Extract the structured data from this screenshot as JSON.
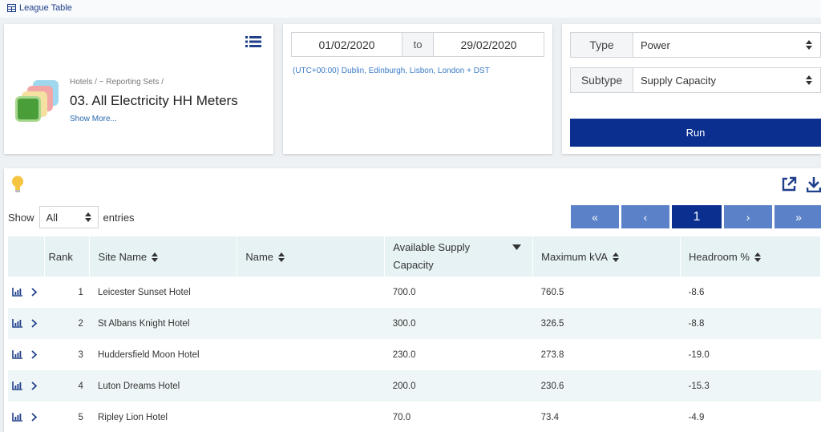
{
  "header": {
    "title": "League Table",
    "title_icon": "table-icon"
  },
  "report": {
    "breadcrumb": "Hotels / ~ Reporting Sets /",
    "set_name": "03. All Electricity HH Meters",
    "show_more": "Show More...",
    "icon_colors": [
      "#9fd8ee",
      "#f2a6a6",
      "#f4e0a0",
      "#4a9e3a"
    ]
  },
  "date_range": {
    "start": "01/02/2020",
    "to_label": "to",
    "end": "29/02/2020",
    "timezone": "(UTC+00:00) Dublin, Edinburgh, Lisbon, London + DST"
  },
  "filters": {
    "type_label": "Type",
    "type_value": "Power",
    "subtype_label": "Subtype",
    "subtype_value": "Supply Capacity",
    "run_label": "Run"
  },
  "entries": {
    "show_label": "Show",
    "value": "All",
    "suffix": "entries"
  },
  "pagination": {
    "first": "«",
    "prev": "‹",
    "current": "1",
    "next": "›",
    "last": "»"
  },
  "table": {
    "headers": [
      "Rank",
      "Site Name",
      "Name",
      "Available Supply Capacity",
      "Maximum kVA",
      "Headroom %"
    ],
    "rows": [
      {
        "rank": "1",
        "site": "Leicester Sunset Hotel",
        "name": "",
        "capacity": "700.0",
        "kva": "760.5",
        "headroom": "-8.6"
      },
      {
        "rank": "2",
        "site": "St Albans Knight Hotel",
        "name": "",
        "capacity": "300.0",
        "kva": "326.5",
        "headroom": "-8.8"
      },
      {
        "rank": "3",
        "site": "Huddersfield Moon Hotel",
        "name": "",
        "capacity": "230.0",
        "kva": "273.8",
        "headroom": "-19.0"
      },
      {
        "rank": "4",
        "site": "Luton Dreams Hotel",
        "name": "",
        "capacity": "200.0",
        "kva": "230.6",
        "headroom": "-15.3"
      },
      {
        "rank": "5",
        "site": "Ripley Lion Hotel",
        "name": "",
        "capacity": "70.0",
        "kva": "73.4",
        "headroom": "-4.9"
      }
    ]
  },
  "colors": {
    "primary": "#0a2f8f",
    "pager": "#5b82c8",
    "header_bg": "#e6f2f4",
    "link": "#3a7bc8"
  }
}
